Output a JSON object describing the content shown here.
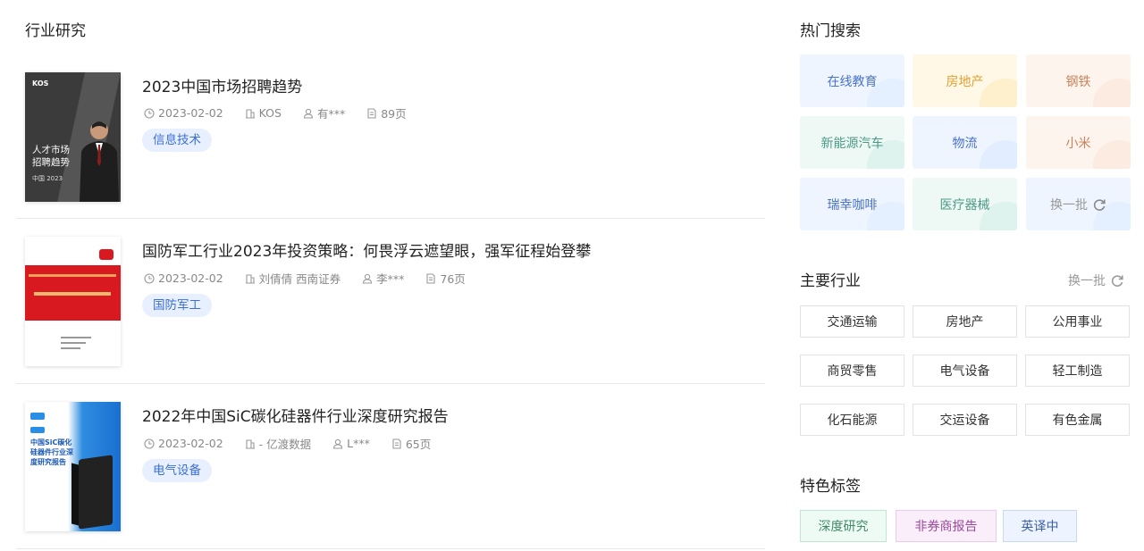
{
  "main": {
    "title": "行业研究",
    "reports": [
      {
        "title": "2023中国市场招聘趋势",
        "date": "2023-02-02",
        "publisher": "KOS",
        "author": "有***",
        "pages": "89页",
        "tag": "信息技术",
        "cover": {
          "logo": "KOS",
          "line1": "人才市场",
          "line2": "招聘趋势",
          "line3": "中国 2023"
        }
      },
      {
        "title": "国防军工行业2023年投资策略：何畏浮云遮望眼，强军征程始登攀",
        "date": "2023-02-02",
        "publisher": "刘倩倩 西南证券",
        "author": "李***",
        "pages": "76页",
        "tag": "国防军工"
      },
      {
        "title": "2022年中国SiC碳化硅器件行业深度研究报告",
        "date": "2023-02-02",
        "publisher": "- 亿渡数据",
        "author": "L***",
        "pages": "65页",
        "tag": "电气设备",
        "cover": {
          "text": "中国SiC碳化硅器件行业深度研究报告"
        }
      }
    ]
  },
  "sidebar": {
    "hot_title": "热门搜索",
    "hot_items": [
      {
        "label": "在线教育",
        "bg": "#eef5ff",
        "blob": "#dce9ff",
        "color": "#4a72c8"
      },
      {
        "label": "房地产",
        "bg": "#fff8e6",
        "blob": "#ffe9b8",
        "color": "#e0a030"
      },
      {
        "label": "钢铁",
        "bg": "#fdf4ee",
        "blob": "#f9e3d5",
        "color": "#c8835a"
      },
      {
        "label": "新能源汽车",
        "bg": "#eef8f5",
        "blob": "#d2eee6",
        "color": "#4c9a86"
      },
      {
        "label": "物流",
        "bg": "#eef5ff",
        "blob": "#d9e8ff",
        "color": "#4a72c8"
      },
      {
        "label": "小米",
        "bg": "#fdf4ee",
        "blob": "#f9e3d5",
        "color": "#c8835a"
      },
      {
        "label": "瑞幸咖啡",
        "bg": "#eef5ff",
        "blob": "#dce9ff",
        "color": "#4a72c8"
      },
      {
        "label": "医疗器械",
        "bg": "#eef8f5",
        "blob": "#d2eee6",
        "color": "#4c9a86"
      }
    ],
    "hot_refresh": "换一批",
    "industry_title": "主要行业",
    "industry_refresh": "换一批",
    "industries": [
      "交通运输",
      "房地产",
      "公用事业",
      "商贸零售",
      "电气设备",
      "轻工制造",
      "化石能源",
      "交运设备",
      "有色金属"
    ],
    "featured_title": "特色标签",
    "featured": [
      {
        "label": "深度研究",
        "bg": "#eefaf4",
        "border": "#bfe6d2",
        "color": "#3f8a6a"
      },
      {
        "label": "非券商报告",
        "bg": "#fbeefb",
        "border": "#eec9ee",
        "color": "#9a4a9a"
      },
      {
        "label": "英译中",
        "bg": "#eef4ff",
        "border": "#c8d9f5",
        "color": "#3b5fa8"
      }
    ]
  }
}
